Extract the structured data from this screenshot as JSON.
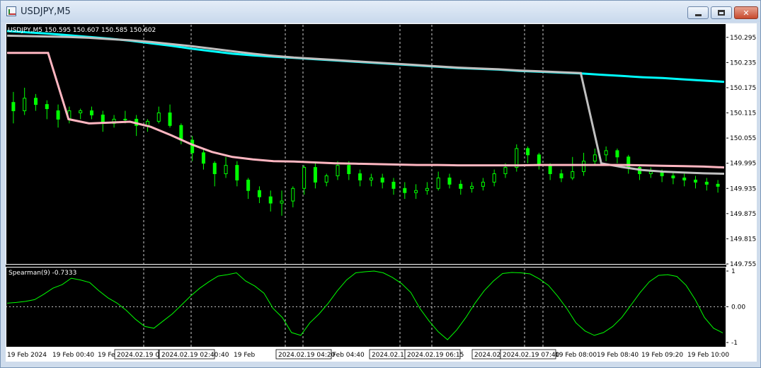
{
  "window": {
    "title": "USDJPY,M5",
    "minimize_glyph": "minimize-icon",
    "maximize_glyph": "maximize-icon",
    "close_label": "✕"
  },
  "price_panel": {
    "info": "USDJPY,M5  150.595 150.607 150.585 150.602",
    "price_labels": [
      "150.295",
      "150.235",
      "150.175",
      "150.115",
      "150.055",
      "149.995",
      "149.935",
      "149.875",
      "149.815",
      "149.755"
    ]
  },
  "indicator_panel": {
    "info": "Spearman(9) -0.7333",
    "level_labels": [
      "1",
      "0.00",
      "-1"
    ]
  },
  "time_axis": {
    "labels": [
      "19 Feb 2024",
      "19 Feb 00:40",
      "19 Feb",
      ":40",
      "19 Feb",
      "Feb 04:40",
      "19 Feb 08:00",
      "19 Feb 08:40",
      "19 Feb 09:20",
      "19 Feb 10:00"
    ],
    "highlight_labels": [
      "2024.02.19 02",
      "2024.02.19 02:40",
      "2024.02.19 04:20",
      "2024.02.1:",
      "2024.02.19 06:15",
      "2024.02.",
      "2024.02.19 07:40"
    ]
  },
  "colors": {
    "background": "#000000",
    "candles": "#00ff00",
    "ma_cyan": "#00ffff",
    "ma_gray": "#c0c0c0",
    "ma_pink": "#ffb6c1",
    "spearman_line": "#00ff00"
  },
  "chart_data": {
    "type": "candlestick",
    "symbol": "USDJPY",
    "timeframe": "M5",
    "ylim": [
      149.755,
      150.325
    ],
    "series": [
      {
        "values": [
          150.31,
          150.307,
          150.304,
          150.3,
          150.296,
          150.292,
          150.287,
          150.281,
          150.275,
          150.268,
          150.262,
          150.256,
          150.252,
          150.249,
          150.246,
          150.243,
          150.24,
          150.237,
          150.234,
          150.231,
          150.228,
          150.225,
          150.222,
          150.22,
          150.218,
          150.215,
          150.213,
          150.211,
          150.209,
          150.206,
          150.203,
          150.2,
          150.198,
          150.195,
          150.192,
          150.189
        ]
      },
      {
        "values": [
          150.299,
          150.298,
          150.297,
          150.296,
          150.294,
          150.291,
          150.288,
          150.284,
          150.279,
          150.274,
          150.268,
          150.262,
          150.256,
          150.251,
          150.247,
          150.244,
          150.241,
          150.238,
          150.235,
          150.232,
          150.229,
          150.226,
          150.223,
          150.221,
          150.219,
          150.216,
          150.214,
          150.212,
          150.21,
          149.995,
          149.986,
          149.979,
          149.975,
          149.973,
          149.971,
          149.97
        ]
      },
      {
        "values": [
          150.258,
          150.258,
          150.258,
          150.1,
          150.09,
          150.092,
          150.094,
          150.082,
          150.062,
          150.04,
          150.022,
          150.01,
          150.004,
          150.0,
          149.999,
          149.997,
          149.995,
          149.994,
          149.993,
          149.992,
          149.991,
          149.991,
          149.99,
          149.99,
          149.99,
          149.99,
          149.991,
          149.991,
          149.991,
          149.991,
          149.991,
          149.99,
          149.989,
          149.988,
          149.987,
          149.985
        ]
      },
      {
        "values": [
          0.1,
          0.12,
          0.15,
          0.2,
          0.35,
          0.52,
          0.62,
          0.8,
          0.75,
          0.68,
          0.45,
          0.25,
          0.1,
          -0.1,
          -0.35,
          -0.55,
          -0.6,
          -0.4,
          -0.2,
          0.05,
          0.3,
          0.52,
          0.7,
          0.86,
          0.9,
          0.95,
          0.72,
          0.58,
          0.38,
          -0.05,
          -0.3,
          -0.72,
          -0.8,
          -0.45,
          -0.2,
          0.1,
          0.45,
          0.75,
          0.95,
          0.98,
          1.0,
          0.95,
          0.82,
          0.65,
          0.4,
          -0.05,
          -0.4,
          -0.7,
          -0.92,
          -0.65,
          -0.3,
          0.1,
          0.45,
          0.72,
          0.93,
          0.96,
          0.95,
          0.92,
          0.78,
          0.6,
          0.3,
          -0.05,
          -0.45,
          -0.68,
          -0.8,
          -0.72,
          -0.55,
          -0.3,
          0.05,
          0.4,
          0.7,
          0.88,
          0.9,
          0.85,
          0.6,
          0.2,
          -0.3,
          -0.6,
          -0.73
        ]
      }
    ],
    "candles": [
      [
        150.14,
        150.12,
        150.165,
        150.09
      ],
      [
        150.12,
        150.15,
        150.175,
        150.11
      ],
      [
        150.15,
        150.135,
        150.16,
        150.12
      ],
      [
        150.135,
        150.125,
        150.145,
        150.1
      ],
      [
        150.12,
        150.1,
        150.135,
        150.08
      ],
      [
        150.1,
        150.12,
        150.13,
        150.09
      ],
      [
        150.115,
        150.12,
        150.125,
        150.1
      ],
      [
        150.12,
        150.11,
        150.13,
        150.1
      ],
      [
        150.11,
        150.09,
        150.12,
        150.07
      ],
      [
        150.09,
        150.1,
        150.11,
        150.08
      ],
      [
        150.1,
        150.1,
        150.12,
        150.09
      ],
      [
        150.1,
        150.085,
        150.11,
        150.06
      ],
      [
        150.085,
        150.095,
        150.1,
        150.07
      ],
      [
        150.095,
        150.115,
        150.13,
        150.09
      ],
      [
        150.115,
        150.085,
        150.135,
        150.08
      ],
      [
        150.085,
        150.05,
        150.09,
        150.04
      ],
      [
        150.05,
        150.02,
        150.06,
        150.0
      ],
      [
        150.02,
        149.995,
        150.03,
        149.98
      ],
      [
        149.995,
        149.97,
        150.0,
        149.94
      ],
      [
        149.97,
        149.99,
        150.01,
        149.96
      ],
      [
        149.99,
        149.955,
        150.0,
        149.94
      ],
      [
        149.955,
        149.93,
        149.96,
        149.91
      ],
      [
        149.93,
        149.915,
        149.94,
        149.9
      ],
      [
        149.915,
        149.9,
        149.93,
        149.88
      ],
      [
        149.9,
        149.905,
        149.93,
        149.87
      ],
      [
        149.905,
        149.935,
        149.94,
        149.89
      ],
      [
        149.935,
        149.985,
        149.99,
        149.92
      ],
      [
        149.985,
        149.95,
        149.995,
        149.935
      ],
      [
        149.95,
        149.965,
        149.97,
        149.94
      ],
      [
        149.965,
        149.99,
        150.0,
        149.955
      ],
      [
        149.99,
        149.97,
        150.0,
        149.955
      ],
      [
        149.97,
        149.955,
        149.98,
        149.94
      ],
      [
        149.955,
        149.96,
        149.97,
        149.94
      ],
      [
        149.96,
        149.95,
        149.97,
        149.935
      ],
      [
        149.95,
        149.935,
        149.96,
        149.92
      ],
      [
        149.935,
        149.925,
        149.95,
        149.91
      ],
      [
        149.925,
        149.93,
        149.945,
        149.91
      ],
      [
        149.93,
        149.935,
        149.95,
        149.92
      ],
      [
        149.935,
        149.96,
        149.975,
        149.93
      ],
      [
        149.96,
        149.945,
        149.97,
        149.935
      ],
      [
        149.945,
        149.935,
        149.955,
        149.92
      ],
      [
        149.935,
        149.94,
        149.95,
        149.925
      ],
      [
        149.94,
        149.95,
        149.96,
        149.93
      ],
      [
        149.95,
        149.97,
        149.98,
        149.94
      ],
      [
        149.97,
        149.985,
        149.995,
        149.96
      ],
      [
        149.985,
        150.03,
        150.04,
        149.975
      ],
      [
        150.03,
        150.015,
        150.035,
        149.995
      ],
      [
        150.015,
        149.99,
        150.02,
        149.98
      ],
      [
        149.99,
        149.97,
        149.995,
        149.955
      ],
      [
        149.97,
        149.96,
        149.98,
        149.95
      ],
      [
        149.96,
        149.975,
        150.01,
        149.955
      ],
      [
        149.975,
        150.0,
        150.02,
        149.965
      ],
      [
        150.0,
        150.015,
        150.03,
        149.99
      ],
      [
        150.015,
        150.025,
        150.035,
        150.0
      ],
      [
        150.025,
        150.01,
        150.03,
        149.995
      ],
      [
        150.01,
        149.985,
        150.015,
        149.97
      ],
      [
        149.985,
        149.97,
        149.99,
        149.955
      ],
      [
        149.97,
        149.975,
        149.985,
        149.96
      ],
      [
        149.975,
        149.965,
        149.98,
        149.95
      ],
      [
        149.965,
        149.96,
        149.975,
        149.945
      ],
      [
        149.96,
        149.955,
        149.97,
        149.94
      ],
      [
        149.955,
        149.95,
        149.965,
        149.935
      ],
      [
        149.95,
        149.945,
        149.96,
        149.93
      ],
      [
        149.945,
        149.94,
        149.955,
        149.925
      ]
    ]
  }
}
